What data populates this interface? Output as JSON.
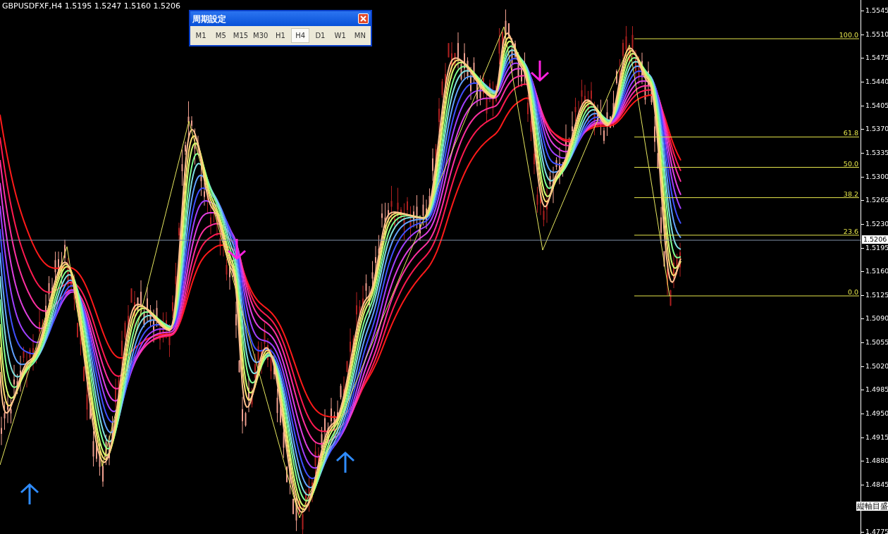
{
  "header": {
    "symbol": "GBPUSDFXF,H4",
    "ohlc": "1.5195 1.5247 1.5160 1.5206"
  },
  "period_dialog": {
    "title": "周期設定",
    "periods": [
      {
        "label": "M1",
        "selected": false
      },
      {
        "label": "M5",
        "selected": false
      },
      {
        "label": "M15",
        "selected": false
      },
      {
        "label": "M30",
        "selected": false
      },
      {
        "label": "H1",
        "selected": false
      },
      {
        "label": "H4",
        "selected": true
      },
      {
        "label": "D1",
        "selected": false
      },
      {
        "label": "W1",
        "selected": false
      },
      {
        "label": "MN",
        "selected": false
      }
    ]
  },
  "fibonacci_levels": [
    "100.0",
    "61.8",
    "50.0",
    "38.2",
    "23.6",
    "0.0"
  ],
  "price_axis": {
    "ticks": [
      "1.5545",
      "1.5510",
      "1.5475",
      "1.5440",
      "1.5405",
      "1.5370",
      "1.5335",
      "1.5300",
      "1.5265",
      "1.5230",
      "1.5195",
      "1.5160",
      "1.5125",
      "1.5090",
      "1.5055",
      "1.5020",
      "1.4985",
      "1.4950",
      "1.4915",
      "1.4880",
      "1.4845",
      "1.4775"
    ],
    "current_price": "1.5206",
    "caption": "縦軸目盛"
  }
}
